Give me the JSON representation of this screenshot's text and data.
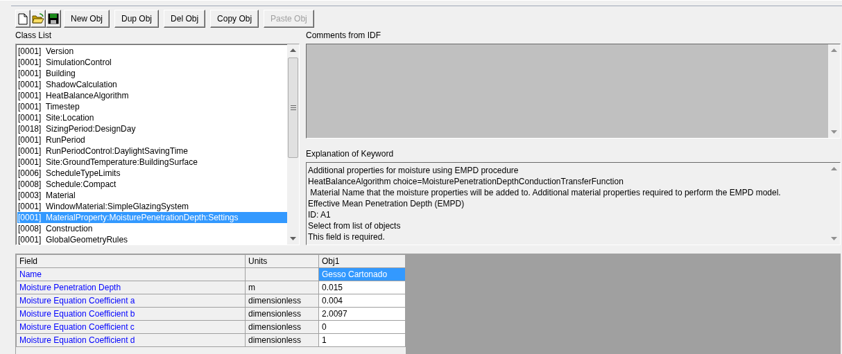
{
  "toolbar": [
    {
      "kind": "new-icon"
    },
    {
      "kind": "open-icon"
    },
    {
      "kind": "save-icon"
    },
    {
      "kind": "text",
      "label": "New Obj",
      "disabled": false
    },
    {
      "kind": "text",
      "label": "Dup Obj",
      "disabled": false
    },
    {
      "kind": "text",
      "label": "Del Obj",
      "disabled": false
    },
    {
      "kind": "text",
      "label": "Copy Obj",
      "disabled": false
    },
    {
      "kind": "text",
      "label": "Paste Obj",
      "disabled": true
    }
  ],
  "class_list": {
    "label": "Class List",
    "items": [
      {
        "count": "[0001]",
        "name": "Version",
        "selected": false
      },
      {
        "count": "[0001]",
        "name": "SimulationControl",
        "selected": false
      },
      {
        "count": "[0001]",
        "name": "Building",
        "selected": false
      },
      {
        "count": "[0001]",
        "name": "ShadowCalculation",
        "selected": false
      },
      {
        "count": "[0001]",
        "name": "HeatBalanceAlgorithm",
        "selected": false
      },
      {
        "count": "[0001]",
        "name": "Timestep",
        "selected": false
      },
      {
        "count": "[0001]",
        "name": "Site:Location",
        "selected": false
      },
      {
        "count": "[0018]",
        "name": "SizingPeriod:DesignDay",
        "selected": false
      },
      {
        "count": "[0001]",
        "name": "RunPeriod",
        "selected": false
      },
      {
        "count": "[0001]",
        "name": "RunPeriodControl:DaylightSavingTime",
        "selected": false
      },
      {
        "count": "[0001]",
        "name": "Site:GroundTemperature:BuildingSurface",
        "selected": false
      },
      {
        "count": "[0006]",
        "name": "ScheduleTypeLimits",
        "selected": false
      },
      {
        "count": "[0008]",
        "name": "Schedule:Compact",
        "selected": false
      },
      {
        "count": "[0003]",
        "name": "Material",
        "selected": false
      },
      {
        "count": "[0001]",
        "name": "WindowMaterial:SimpleGlazingSystem",
        "selected": false
      },
      {
        "count": "[0001]",
        "name": "MaterialProperty:MoisturePenetrationDepth:Settings",
        "selected": true
      },
      {
        "count": "[0008]",
        "name": "Construction",
        "selected": false
      },
      {
        "count": "[0001]",
        "name": "GlobalGeometryRules",
        "selected": false
      }
    ]
  },
  "comments": {
    "label": "Comments from IDF"
  },
  "explanation": {
    "label": "Explanation of Keyword",
    "lines": [
      "Additional properties for moisture using EMPD procedure",
      "HeatBalanceAlgorithm choice=MoisturePenetrationDepthConductionTransferFunction",
      " Material Name that the moisture properties will be added to. Additional material properties required to perform the EMPD model.",
      "Effective Mean Penetration Depth (EMPD)",
      "ID: A1",
      "Select from list of objects",
      "This field is required."
    ]
  },
  "grid": {
    "columns": [
      "Field",
      "Units",
      "Obj1"
    ],
    "rows": [
      {
        "field": "Name",
        "units": "",
        "value": "Gesso Cartonado",
        "selected": true
      },
      {
        "field": "Moisture Penetration Depth",
        "units": "m",
        "value": "0.015",
        "selected": false
      },
      {
        "field": "Moisture Equation Coefficient a",
        "units": "dimensionless",
        "value": "0.004",
        "selected": false
      },
      {
        "field": "Moisture Equation Coefficient b",
        "units": "dimensionless",
        "value": "2.0097",
        "selected": false
      },
      {
        "field": "Moisture Equation Coefficient c",
        "units": "dimensionless",
        "value": "0",
        "selected": false
      },
      {
        "field": "Moisture Equation Coefficient d",
        "units": "dimensionless",
        "value": "1",
        "selected": false
      }
    ]
  }
}
